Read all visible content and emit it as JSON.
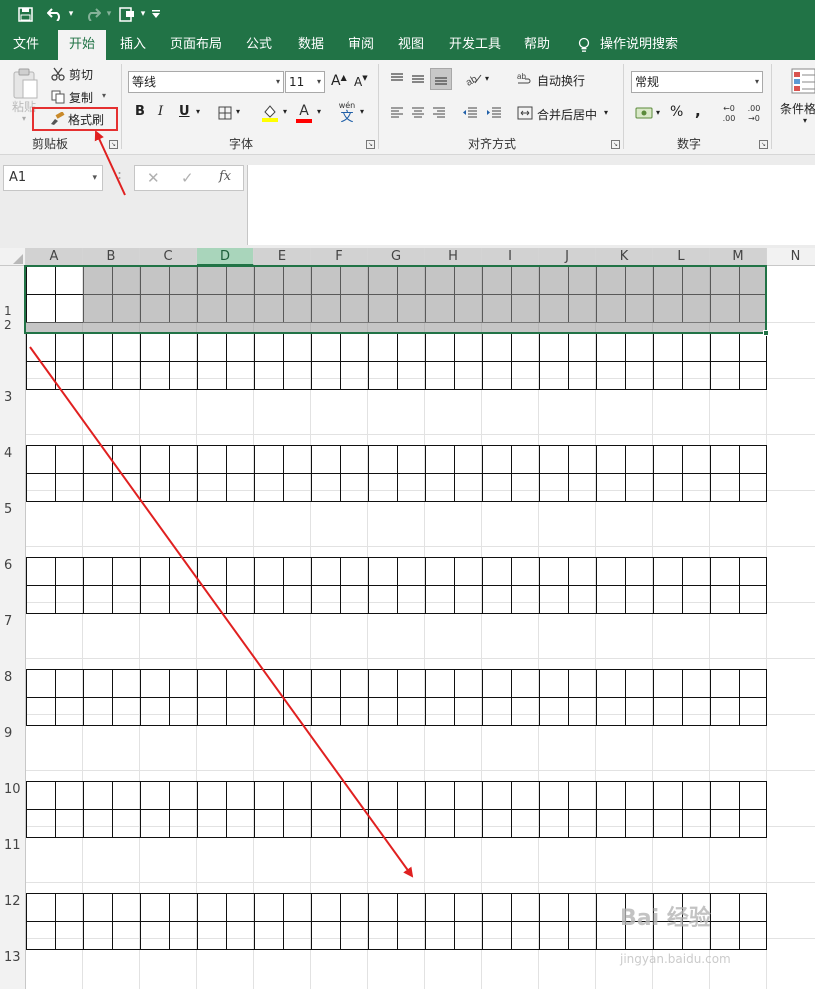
{
  "qat": {
    "save_icon": "save-icon",
    "undo_icon": "undo-icon",
    "redo_icon": "redo-icon",
    "form_icon": "form-icon",
    "customize_icon": "customize-qat-icon"
  },
  "tabs": [
    {
      "label": "文件",
      "active": false
    },
    {
      "label": "开始",
      "active": true
    },
    {
      "label": "插入",
      "active": false
    },
    {
      "label": "页面布局",
      "active": false
    },
    {
      "label": "公式",
      "active": false
    },
    {
      "label": "数据",
      "active": false
    },
    {
      "label": "审阅",
      "active": false
    },
    {
      "label": "视图",
      "active": false
    },
    {
      "label": "开发工具",
      "active": false
    },
    {
      "label": "帮助",
      "active": false
    }
  ],
  "tell_me": "操作说明搜索",
  "clipboard": {
    "paste_label": "粘贴",
    "cut_label": "剪切",
    "copy_label": "复制",
    "format_painter_label": "格式刷",
    "group_label": "剪贴板"
  },
  "font": {
    "font_name": "等线",
    "font_size": "11",
    "increase_size": "A",
    "decrease_size": "A",
    "bold": "B",
    "italic": "I",
    "underline": "U",
    "font_color_letter": "A",
    "phonetic_label": "wén",
    "phonetic_char": "文",
    "group_label": "字体",
    "fill_color": "#ffff00",
    "text_color": "#ff0000"
  },
  "alignment": {
    "wrap_text_label": "自动换行",
    "merge_center_label": "合并后居中",
    "group_label": "对齐方式"
  },
  "number": {
    "format_value": "常规",
    "percent": "%",
    "comma": ",",
    "increase_decimal_top": "←0",
    "increase_decimal_bottom": ".00",
    "decrease_decimal_top": ".00",
    "decrease_decimal_bottom": "→0",
    "group_label": "数字"
  },
  "styles": {
    "conditional_format_label": "条件格"
  },
  "formula_bar": {
    "name_box": "A1",
    "fx_label": "fx",
    "value": ""
  },
  "columns": [
    "A",
    "B",
    "C",
    "D",
    "E",
    "F",
    "G",
    "H",
    "I",
    "J",
    "K",
    "L",
    "M",
    "N"
  ],
  "rows": [
    "1",
    "2",
    "3",
    "4",
    "5",
    "6",
    "7",
    "8",
    "9",
    "10",
    "11",
    "12",
    "13"
  ],
  "watermark": {
    "text": "Bai 经验",
    "sub": "jingyan.baidu.com"
  },
  "colors": {
    "excel_green": "#217346",
    "selection_fill": "#9a9a9a",
    "annotation_red": "#e02020",
    "ribbon_bg": "#f3f3f3"
  }
}
